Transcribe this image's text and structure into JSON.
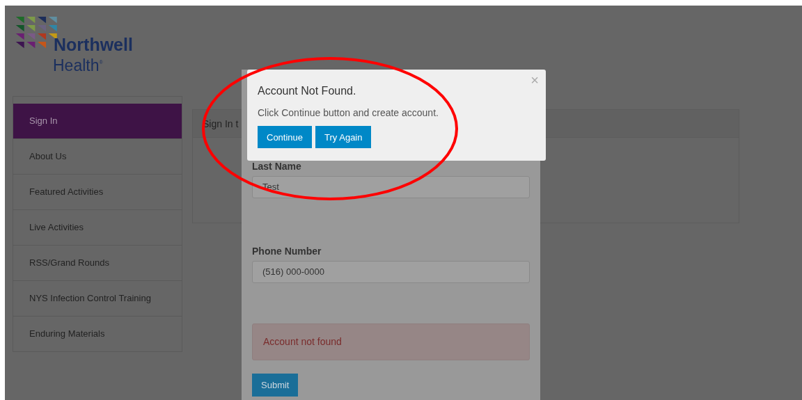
{
  "logo": {
    "name": "Northwell",
    "sub": "Health",
    "mark": "®"
  },
  "sidebar": {
    "items": [
      {
        "label": "Sign In",
        "selected": true
      },
      {
        "label": "About Us",
        "selected": false
      },
      {
        "label": "Featured Activities",
        "selected": false
      },
      {
        "label": "Live Activities",
        "selected": false
      },
      {
        "label": "RSS/Grand Rounds",
        "selected": false
      },
      {
        "label": "NYS Infection Control Training",
        "selected": false
      },
      {
        "label": "Enduring Materials",
        "selected": false
      }
    ]
  },
  "panel": {
    "title": "Sign In t"
  },
  "form": {
    "fields": [
      {
        "label": "Last Name",
        "value": "Test"
      },
      {
        "label": "Phone Number",
        "value": "(516) 000-0000"
      }
    ],
    "alert": "Account not found",
    "submit": "Submit"
  },
  "dialog": {
    "title": "Account Not Found.",
    "message": "Click Continue button and create account.",
    "close": "×",
    "buttons": [
      "Continue",
      "Try Again"
    ]
  }
}
